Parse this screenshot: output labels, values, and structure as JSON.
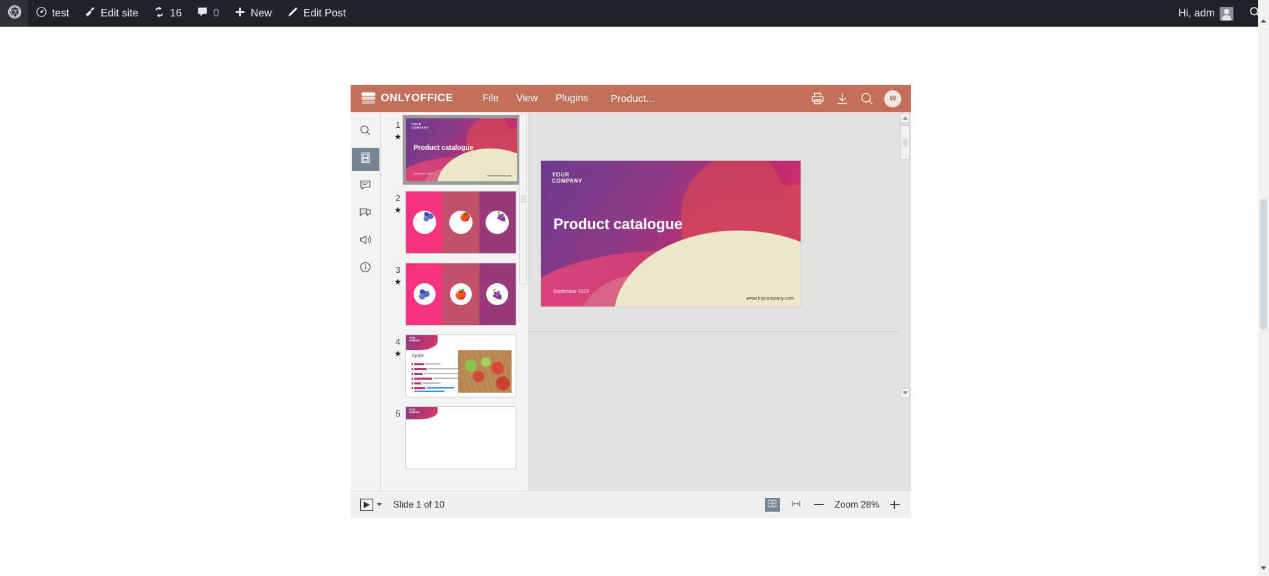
{
  "admin_bar": {
    "logo_icon": "wordpress-logo-icon",
    "items": [
      {
        "icon": "dashboard-icon",
        "label": "test"
      },
      {
        "icon": "brush-icon",
        "label": "Edit site"
      },
      {
        "icon": "updates-icon",
        "label": "16"
      },
      {
        "icon": "comment-bubble-icon",
        "label": "0"
      },
      {
        "icon": "plus-icon",
        "label": "New"
      },
      {
        "icon": "pencil-icon",
        "label": "Edit Post"
      }
    ],
    "greeting": "Hi, adm",
    "avatar_icon": "user-avatar-icon",
    "search_icon": "search-icon"
  },
  "editor": {
    "brand": "ONLYOFFICE",
    "brand_logo_icon": "onlyoffice-layers-icon",
    "menu": [
      {
        "label": "File"
      },
      {
        "label": "View"
      },
      {
        "label": "Plugins"
      }
    ],
    "document_tab": "Product...",
    "header_icons": [
      {
        "name": "print-icon"
      },
      {
        "name": "download-icon"
      },
      {
        "name": "search-icon"
      }
    ],
    "user_avatar_initials": "W",
    "header_color": "#c2705a",
    "accent_active": "#778492"
  },
  "rail": {
    "items": [
      {
        "icon": "search-icon",
        "label": "Search",
        "active": false
      },
      {
        "icon": "slides-icon",
        "label": "Slides",
        "active": true
      },
      {
        "icon": "comments-icon",
        "label": "Comments",
        "active": false
      },
      {
        "icon": "chat-icon",
        "label": "Chat",
        "active": false
      },
      {
        "icon": "feedback-megaphone-icon",
        "label": "Feedback & Support",
        "active": false
      },
      {
        "icon": "info-icon",
        "label": "About",
        "active": false
      }
    ]
  },
  "thumbnails": [
    {
      "number": "1",
      "star_icon": "star-icon",
      "type": "title",
      "selected": true
    },
    {
      "number": "2",
      "star_icon": "star-icon",
      "type": "fruit-grid-top",
      "selected": false
    },
    {
      "number": "3",
      "star_icon": "star-icon",
      "type": "fruit-grid-center",
      "selected": false
    },
    {
      "number": "4",
      "star_icon": "star-icon",
      "type": "content",
      "selected": false
    },
    {
      "number": "5",
      "star_icon": "star-icon",
      "type": "content",
      "selected": false
    }
  ],
  "slide": {
    "company_line1": "YOUR",
    "company_line2": "COMPANY",
    "title": "Product catalogue",
    "date": "September 2023",
    "website": "www.mycompany.com",
    "fruit_emojis": [
      "🫐",
      "🍎",
      "🍇"
    ],
    "slide4_title": "Apple"
  },
  "status_bar": {
    "start_slideshow_icon": "play-icon",
    "slideshow_dropdown_icon": "chevron-down-icon",
    "slide_counter": "Slide 1 of 10",
    "fit_slide_icon": "fit-to-slide-icon",
    "fit_width_icon": "fit-to-width-icon",
    "zoom_out_icon": "minus-icon",
    "zoom_label": "Zoom 28%",
    "zoom_in_icon": "plus-icon"
  }
}
